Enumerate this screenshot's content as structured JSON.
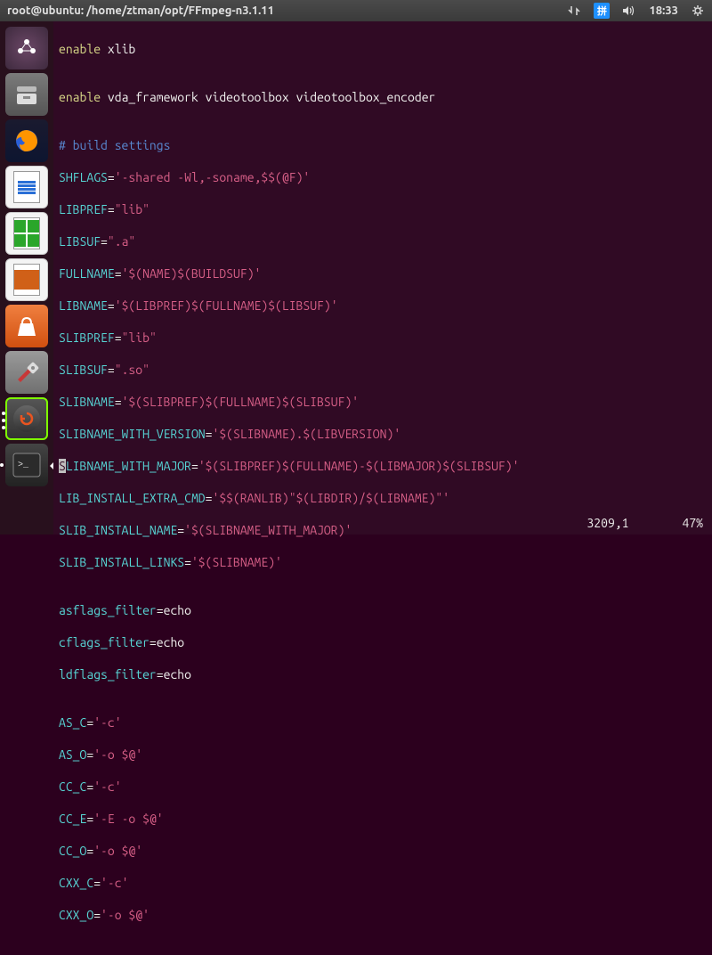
{
  "top_bar": {
    "title": "root@ubuntu: /home/ztman/opt/FFmpeg-n3.1.11",
    "time": "18:33",
    "input_method": "拼"
  },
  "launcher": {
    "dash": "⌕",
    "files": "🗄",
    "firefox": "🦊",
    "writer": "W",
    "calc": "C",
    "impress": "I",
    "software": "A",
    "settings": "🔧",
    "updater": "↻",
    "terminal": ">_"
  },
  "terminal": {
    "l1a": "enable ",
    "l1b": "xlib",
    "l2": "",
    "l3a": "enable ",
    "l3b": "vda_framework videotoolbox videotoolbox_encoder",
    "l4": "",
    "l5": "# build settings",
    "l6a": "SHFLAGS",
    "l6b": "=",
    "l6c": "'-shared -Wl,-soname,$$(@F)'",
    "l7a": "LIBPREF",
    "l7b": "=",
    "l7c": "\"lib\"",
    "l8a": "LIBSUF",
    "l8b": "=",
    "l8c": "\".a\"",
    "l9a": "FULLNAME",
    "l9b": "=",
    "l9c": "'$(NAME)$(BUILDSUF)'",
    "l10a": "LIBNAME",
    "l10b": "=",
    "l10c": "'$(LIBPREF)$(FULLNAME)$(LIBSUF)'",
    "l11a": "SLIBPREF",
    "l11b": "=",
    "l11c": "\"lib\"",
    "l12a": "SLIBSUF",
    "l12b": "=",
    "l12c": "\".so\"",
    "l13a": "SLIBNAME",
    "l13b": "=",
    "l13c": "'$(SLIBPREF)$(FULLNAME)$(SLIBSUF)'",
    "l14a": "SLIBNAME_WITH_VERSION",
    "l14b": "=",
    "l14c": "'$(SLIBNAME).$(LIBVERSION)'",
    "l15cur": "S",
    "l15a": "LIBNAME_WITH_MAJOR",
    "l15b": "=",
    "l15c": "'$(SLIBPREF)$(FULLNAME)-$(LIBMAJOR)$(SLIBSUF)'",
    "l16a": "LIB_INSTALL_EXTRA_CMD",
    "l16b": "=",
    "l16c": "'$$(RANLIB)\"$(LIBDIR)/$(LIBNAME)\"'",
    "l17a": "SLIB_INSTALL_NAME",
    "l17b": "=",
    "l17c": "'$(SLIBNAME_WITH_MAJOR)'",
    "l18a": "SLIB_INSTALL_LINKS",
    "l18b": "=",
    "l18c": "'$(SLIBNAME)'",
    "l19": "",
    "l20a": "asflags_filter",
    "l20b": "=echo",
    "l21a": "cflags_filter",
    "l21b": "=echo",
    "l22a": "ldflags_filter",
    "l22b": "=echo",
    "l23": "",
    "l24a": "AS_C",
    "l24b": "=",
    "l24c": "'-c'",
    "l25a": "AS_O",
    "l25b": "=",
    "l25c": "'-o $@'",
    "l26a": "CC_C",
    "l26b": "=",
    "l26c": "'-c'",
    "l27a": "CC_E",
    "l27b": "=",
    "l27c": "'-E -o $@'",
    "l28a": "CC_O",
    "l28b": "=",
    "l28c": "'-o $@'",
    "l29a": "CXX_C",
    "l29b": "=",
    "l29c": "'-c'",
    "l30a": "CXX_O",
    "l30b": "=",
    "l30c": "'-o $@'"
  },
  "status": {
    "pos": "3209,1",
    "pct": "47%"
  }
}
